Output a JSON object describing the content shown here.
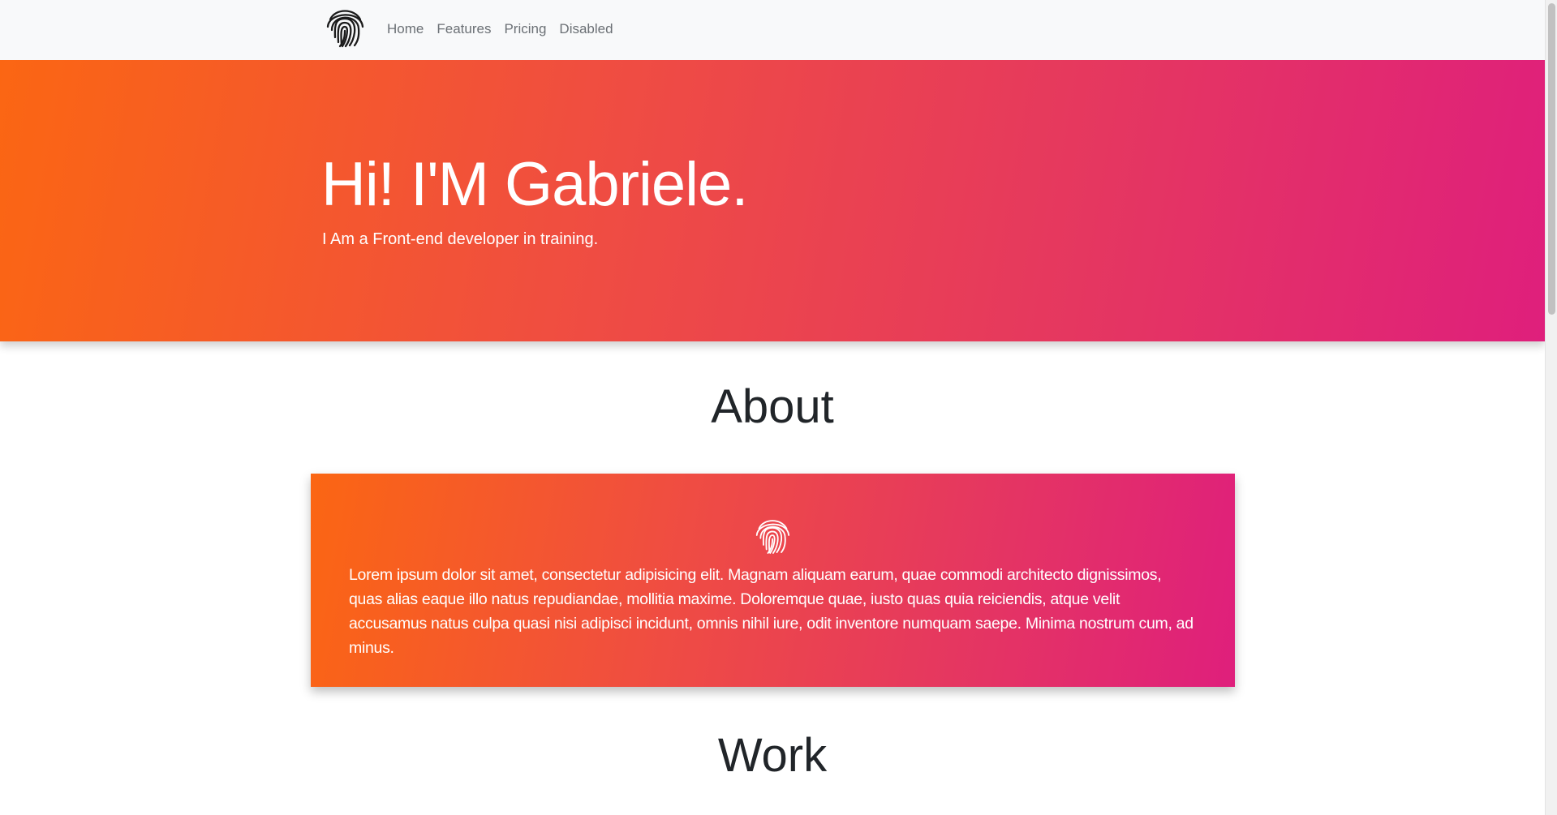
{
  "navbar": {
    "brand_icon": "fingerprint-icon",
    "links": [
      {
        "label": "Home"
      },
      {
        "label": "Features"
      },
      {
        "label": "Pricing"
      },
      {
        "label": "Disabled"
      }
    ]
  },
  "hero": {
    "title": "Hi! I'M Gabriele.",
    "subtitle": "I Am a Front-end developer in training.",
    "gradient_colors": [
      "#fb6613",
      "#df1f7c"
    ]
  },
  "about": {
    "heading": "About",
    "icon": "fingerprint-icon",
    "text": "Lorem ipsum dolor sit amet, consectetur adipisicing elit. Magnam aliquam earum, quae commodi architecto dignissimos, quas alias eaque illo natus repudiandae, mollitia maxime. Doloremque quae, iusto quas quia reiciendis, atque velit accusamus natus culpa quasi nisi adipisci incidunt, omnis nihil iure, odit inventore numquam saepe. Minima nostrum cum, ad minus."
  },
  "work": {
    "heading": "Work"
  }
}
